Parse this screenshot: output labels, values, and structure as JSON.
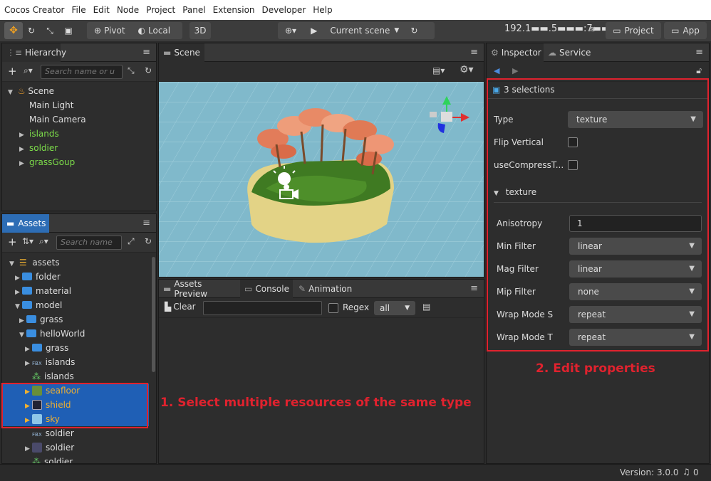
{
  "menubar": {
    "items": [
      "Cocos Creator",
      "File",
      "Edit",
      "Node",
      "Project",
      "Panel",
      "Extension",
      "Developer",
      "Help"
    ]
  },
  "toolbar": {
    "pivot_label": "Pivot",
    "local_label": "Local",
    "mode_3d_label": "3D",
    "scene_select_label": "Current scene",
    "ip_label": "192.1▬▬.5▬▬▬:7▬▬▬",
    "project_label": "Project",
    "app_label": "App"
  },
  "hierarchy": {
    "tab_label": "Hierarchy",
    "search_placeholder": "Search name or u",
    "root_label": "Scene",
    "items": [
      {
        "label": "Main Light",
        "prefab": false
      },
      {
        "label": "Main Camera",
        "prefab": false
      },
      {
        "label": "islands",
        "prefab": true
      },
      {
        "label": "soldier",
        "prefab": true
      },
      {
        "label": "grassGoup",
        "prefab": true
      }
    ]
  },
  "scene": {
    "tab_label": "Scene"
  },
  "assets": {
    "tab_label": "Assets",
    "search_placeholder": "Search name",
    "items": [
      {
        "label": "assets",
        "depth": 0,
        "expanded": true
      },
      {
        "label": "folder",
        "depth": 1
      },
      {
        "label": "material",
        "depth": 1
      },
      {
        "label": "model",
        "depth": 1,
        "expanded": true
      },
      {
        "label": "grass",
        "depth": 2
      },
      {
        "label": "helloWorld",
        "depth": 2,
        "expanded": true
      },
      {
        "label": "grass",
        "depth": 3
      },
      {
        "label": "islands",
        "depth": 3,
        "badge": "FBX"
      },
      {
        "label": "islands",
        "depth": 3
      },
      {
        "label": "seafloor",
        "depth": 3
      },
      {
        "label": "shield",
        "depth": 3
      },
      {
        "label": "sky",
        "depth": 3
      },
      {
        "label": "soldier",
        "depth": 3,
        "badge": "FBX"
      },
      {
        "label": "soldier",
        "depth": 3
      },
      {
        "label": "soldier",
        "depth": 3
      }
    ]
  },
  "console": {
    "tabs": [
      "Assets Preview",
      "Console",
      "Animation"
    ],
    "clear_label": "Clear",
    "regex_label": "Regex",
    "filter_value": "all"
  },
  "inspector": {
    "tabs": [
      "Inspector",
      "Service"
    ],
    "selection_title": "3 selections",
    "type_label": "Type",
    "type_value": "texture",
    "flip_label": "Flip Vertical",
    "compress_label": "useCompressT...",
    "section_label": "texture",
    "props": [
      {
        "label": "Anisotropy",
        "value": "1",
        "kind": "input"
      },
      {
        "label": "Min Filter",
        "value": "linear",
        "kind": "select"
      },
      {
        "label": "Mag Filter",
        "value": "linear",
        "kind": "select"
      },
      {
        "label": "Mip Filter",
        "value": "none",
        "kind": "select"
      },
      {
        "label": "Wrap Mode S",
        "value": "repeat",
        "kind": "select"
      },
      {
        "label": "Wrap Mode T",
        "value": "repeat",
        "kind": "select"
      }
    ]
  },
  "annotations": {
    "select_text": "1. Select multiple resources of the same type",
    "edit_text": "2. Edit properties",
    "color": "#e0222e"
  },
  "statusbar": {
    "version": "Version: 3.0.0",
    "notifications": "0"
  }
}
